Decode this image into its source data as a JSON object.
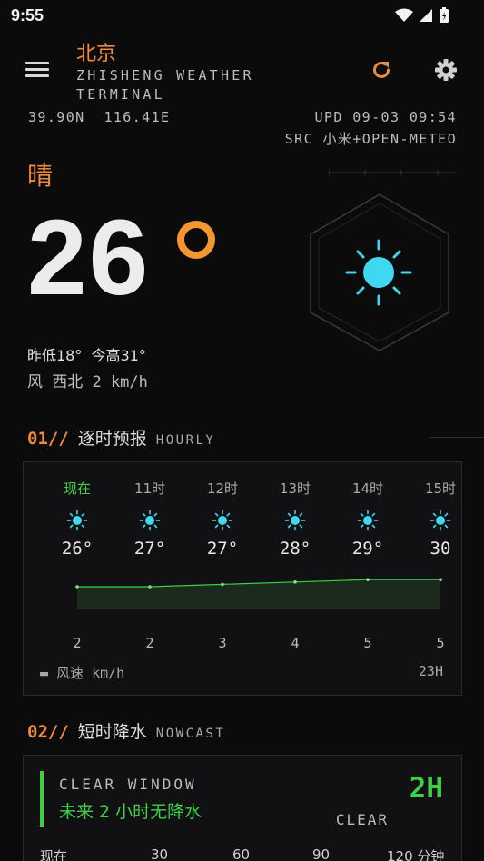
{
  "status_bar": {
    "time": "9:55"
  },
  "header": {
    "city": "北京",
    "app_title_line1": "ZHISHENG WEATHER",
    "app_title_line2": "TERMINAL"
  },
  "location": {
    "coords": "39.90N  116.41E",
    "updated": "UPD 09-03 09:54",
    "source": "SRC 小米+OPEN-METEO"
  },
  "current": {
    "condition": "晴",
    "temperature": "26",
    "minmax": "昨低18°  今高31°",
    "wind": "风 西北 2 km/h",
    "icon": "sun-icon"
  },
  "hourly_section": {
    "num": "01//",
    "title_cn": "逐时预报",
    "title_en": "HOURLY"
  },
  "hourly": [
    {
      "label": "现在",
      "temp": "26°",
      "wind": "2"
    },
    {
      "label": "11时",
      "temp": "27°",
      "wind": "2"
    },
    {
      "label": "12时",
      "temp": "27°",
      "wind": "3"
    },
    {
      "label": "13时",
      "temp": "28°",
      "wind": "4"
    },
    {
      "label": "14时",
      "temp": "29°",
      "wind": "5"
    },
    {
      "label": "15时",
      "temp": "30",
      "wind": "5"
    }
  ],
  "hourly_footer": {
    "legend": "▬ 风速 km/h",
    "range": "23H"
  },
  "nowcast_section": {
    "num": "02//",
    "title_cn": "短时降水",
    "title_en": "NOWCAST"
  },
  "nowcast": {
    "status": "CLEAR WINDOW",
    "message": "未来 2 小时无降水",
    "hours": "2H",
    "state": "CLEAR",
    "axis": [
      "现在",
      "30",
      "60",
      "90",
      "120 分钟"
    ]
  },
  "colors": {
    "accent": "#f08a3c",
    "green": "#3ecf45",
    "sun": "#3fd8f0"
  }
}
